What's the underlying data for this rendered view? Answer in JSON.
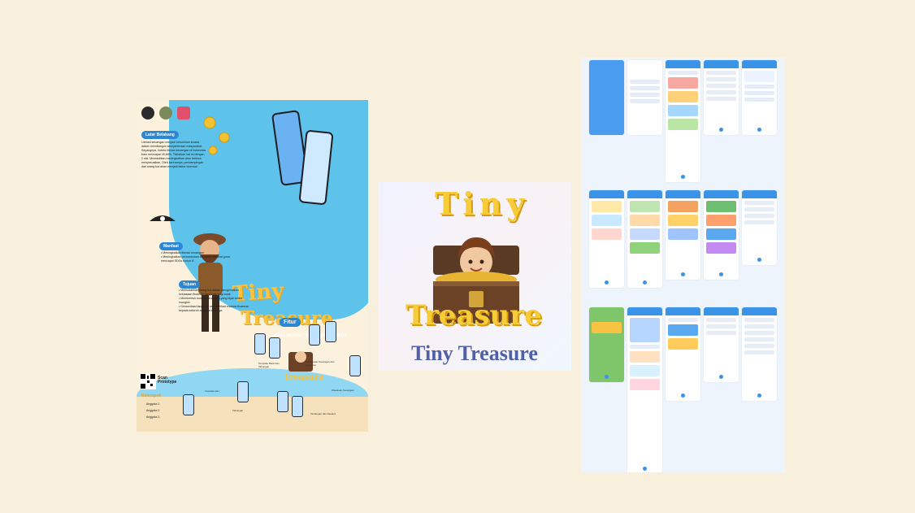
{
  "poster": {
    "section_background": "Latar Belakang",
    "background_text": "Literasi keuangan menjadi kebutuhan krusial dalam membangun kesejahteraan masyarakat. Sayangnya, indeks literasi keuangan di Indonesia baru mencapai 49,68%. Tiktokkan hal ini dengan 2 sisi. Memastikan meningkatkan atau bahkan menyesuaikan. Oleh karenanya, pendampingan dari orang tua akan menjadi faktor esensial.",
    "title_line1": "Tiny",
    "title_line2": "Treasure",
    "tagline": "wise planner for brighter future",
    "section_benefit": "Manfaat",
    "benefits": [
      "Meningkatkan literasi keuangan",
      "Meningkatkan pertumbuhan ekonomi nasional guna mencapai SDGs nomor 8"
    ],
    "section_goal": "Tujuan",
    "goals": [
      "Memudahkan orang tua dalam mengenalkan kebiasaan finansial yang baik bagi anak",
      "Membentuk budaya keuangan yang bijak sedini mungkin",
      "Geosentrasi langsung memberikan edukasi finansial kepada seluruh anggota keluarga"
    ],
    "section_features": "Fitur",
    "features": [
      "Template Bank dan Tabungan",
      "Pencatatan Keuangan dan Anggaran",
      "Wawasan Keuangan",
      "Tabungan",
      "Investasi dan",
      "Tantangan dan Reward"
    ],
    "scan_label": "Scan Prototype",
    "team_label": "Kelompok",
    "members": [
      "Anggota 1",
      "Anggota 2",
      "Anggota 3"
    ]
  },
  "logo_card": {
    "word_top": "Tiny",
    "word_bottom": "Treasure",
    "caption": "Tiny Treasure",
    "caption_color": "#4f5fa8",
    "gold_color": "#f7cc39"
  },
  "board": {
    "screen_rows": 3,
    "accent": "#3b93e8"
  }
}
